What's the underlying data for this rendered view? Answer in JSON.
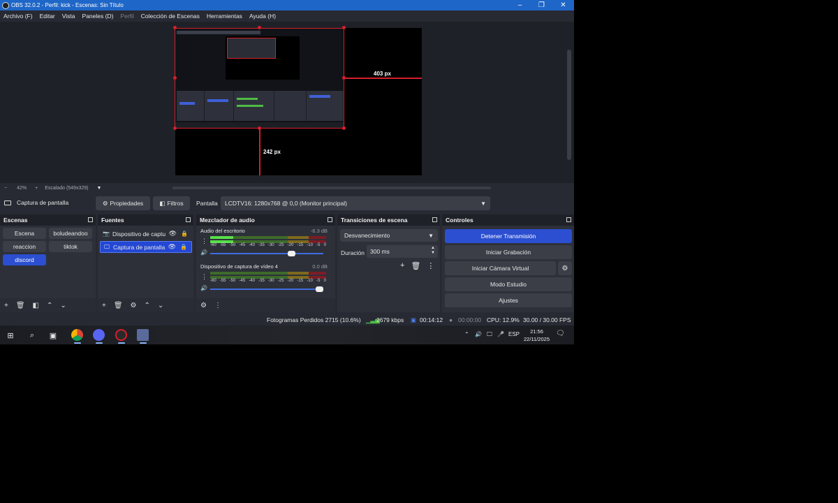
{
  "window": {
    "title": "OBS 32.0.2 - Perfil: kick - Escenas: Sin Título",
    "controls": [
      "–",
      "❐",
      "✕"
    ]
  },
  "menu": [
    {
      "label": "Archivo (F)",
      "enabled": true
    },
    {
      "label": "Editar",
      "enabled": true
    },
    {
      "label": "Vista",
      "enabled": true
    },
    {
      "label": "Paneles (D)",
      "enabled": true
    },
    {
      "label": "Perfil",
      "enabled": false
    },
    {
      "label": "Colección de Escenas",
      "enabled": true
    },
    {
      "label": "Herramientas",
      "enabled": true
    },
    {
      "label": "Ayuda (H)",
      "enabled": true
    }
  ],
  "preview": {
    "width_label": "403 px",
    "height_label": "242 px"
  },
  "zoom": {
    "minus": "−",
    "level": "42%",
    "plus": "+",
    "mode": "Escalado (549x329)",
    "arrow": "▼"
  },
  "source_toolbar": {
    "source_name": "Captura de pantalla",
    "properties": "Propiedades",
    "filters": "Filtros",
    "display_label": "Pantalla",
    "display_value": "LCDTV16: 1280x768 @ 0,0 (Monitor principal)"
  },
  "scenes": {
    "title": "Escenas",
    "items": [
      {
        "label": "Escena",
        "active": false
      },
      {
        "label": "boludeandoo",
        "active": false
      },
      {
        "label": "reaccion",
        "active": false
      },
      {
        "label": "tiktok",
        "active": false
      },
      {
        "label": "discord",
        "active": true
      }
    ]
  },
  "sources": {
    "title": "Fuentes",
    "items": [
      {
        "label": "Dispositivo de captu",
        "icon": "camera-icon",
        "selected": false
      },
      {
        "label": "Captura de pantalla",
        "icon": "monitor-icon",
        "selected": true
      }
    ]
  },
  "mixer": {
    "title": "Mezclador de audio",
    "scale": [
      "-60",
      "-55",
      "-50",
      "-45",
      "-40",
      "-35",
      "-30",
      "-25",
      "-20",
      "-15",
      "-10",
      "-5",
      "0"
    ],
    "tracks": [
      {
        "name": "Audio del escritorio",
        "db": "-6.3 dB",
        "level": 0.2,
        "volume": 0.75
      },
      {
        "name": "Dispositivo de captura de vídeo 4",
        "db": "0.0 dB",
        "level": 0.0,
        "volume": 1.0
      }
    ]
  },
  "transitions": {
    "title": "Transiciones de escena",
    "selected": "Desvanecimiento",
    "duration_label": "Duración",
    "duration_value": "300 ms"
  },
  "controls": {
    "title": "Controles",
    "stop_stream": "Detener Transmisión",
    "start_recording": "Iniciar Grabación",
    "start_virtual_cam": "Iniciar Cámara Virtual",
    "studio_mode": "Modo Estudio",
    "settings": "Ajustes"
  },
  "status": {
    "dropped_frames": "Fotogramas Perdidos 2715 (10.6%)",
    "bitrate": "2679 kbps",
    "stream_time": "00:14:12",
    "record_time": "00:00:00",
    "cpu": "CPU: 12.9%",
    "fps": "30.00 / 30.00 FPS"
  },
  "taskbar": {
    "language": "ESP",
    "time": "21:56",
    "date": "22/11/2025"
  },
  "colors": {
    "accent": "#2b4fd0",
    "selection_red": "#d61f2a",
    "titlebar": "#1e66c7",
    "panel": "#2d3039"
  }
}
